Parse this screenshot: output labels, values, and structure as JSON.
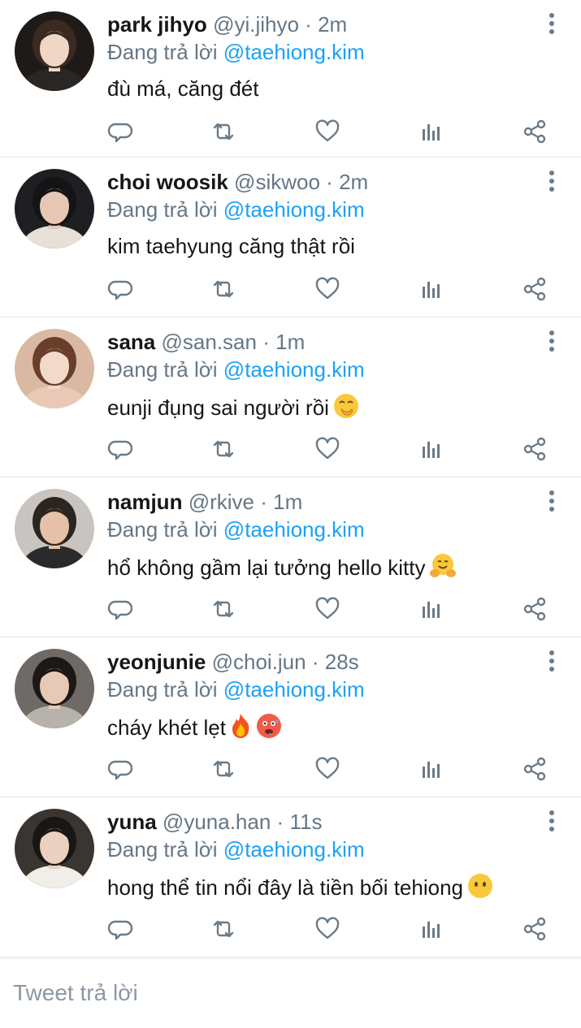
{
  "replies": [
    {
      "name": "park jihyo",
      "handle": "@yi.jihyo",
      "dot": "·",
      "time": "2m",
      "reply_prefix": "Đang trả lời",
      "reply_to": "@taehiong.kim",
      "text": "đù má, căng đét",
      "emojis": [],
      "avatar": {
        "bg": "#1f1a18",
        "skin": "#efd6c6",
        "hair": "#3a2a22",
        "cloth": "#2a2623"
      }
    },
    {
      "name": "choi woosik",
      "handle": "@sikwoo",
      "dot": "·",
      "time": "2m",
      "reply_prefix": "Đang trả lời",
      "reply_to": "@taehiong.kim",
      "text": "kim taehyung căng thật rồi",
      "emojis": [],
      "avatar": {
        "bg": "#1d1f22",
        "skin": "#e7c7b3",
        "hair": "#141414",
        "cloth": "#e6e0d7"
      }
    },
    {
      "name": "sana",
      "handle": "@san.san",
      "dot": "·",
      "time": "1m",
      "reply_prefix": "Đang trả lời",
      "reply_to": "@taehiong.kim",
      "text": "eunji đụng sai người rồi",
      "emojis": [
        "hand-over-mouth-emoji"
      ],
      "avatar": {
        "bg": "#d9b9a4",
        "skin": "#f3d9c9",
        "hair": "#6a3f2a",
        "cloth": "#e9c8b6"
      }
    },
    {
      "name": "namjun",
      "handle": "@rkive",
      "dot": "·",
      "time": "1m",
      "reply_prefix": "Đang trả lời",
      "reply_to": "@taehiong.kim",
      "text": "hổ không gầm lại tưởng hello kitty",
      "emojis": [
        "hugging-emoji"
      ],
      "avatar": {
        "bg": "#c9c4bf",
        "skin": "#e4c1a8",
        "hair": "#2b2522",
        "cloth": "#2a2a2a"
      }
    },
    {
      "name": "yeonjunie",
      "handle": "@choi.jun",
      "dot": "·",
      "time": "28s",
      "reply_prefix": "Đang trả lời",
      "reply_to": "@taehiong.kim",
      "text": "cháy khét lẹt",
      "emojis": [
        "fire-emoji",
        "hot-face-emoji"
      ],
      "avatar": {
        "bg": "#6f6a66",
        "skin": "#e8c9b5",
        "hair": "#1c1816",
        "cloth": "#b8b2ac"
      }
    },
    {
      "name": "yuna",
      "handle": "@yuna.han",
      "dot": "·",
      "time": "11s",
      "reply_prefix": "Đang trả lời",
      "reply_to": "@taehiong.kim",
      "text": "hong thể tin nổi đây là tiền bối tehiong",
      "emojis": [
        "no-mouth-emoji"
      ],
      "avatar": {
        "bg": "#3a3531",
        "skin": "#ead0bf",
        "hair": "#1a1614",
        "cloth": "#f1ede8"
      }
    }
  ],
  "actions": [
    "reply-icon",
    "retweet-icon",
    "like-icon",
    "stats-icon",
    "share-icon"
  ],
  "compose": {
    "placeholder": "Tweet trả lời"
  },
  "colors": {
    "mention": "#1da1f2",
    "meta": "#657786",
    "icon": "#6b7a86",
    "divider": "#e3e6e8"
  }
}
